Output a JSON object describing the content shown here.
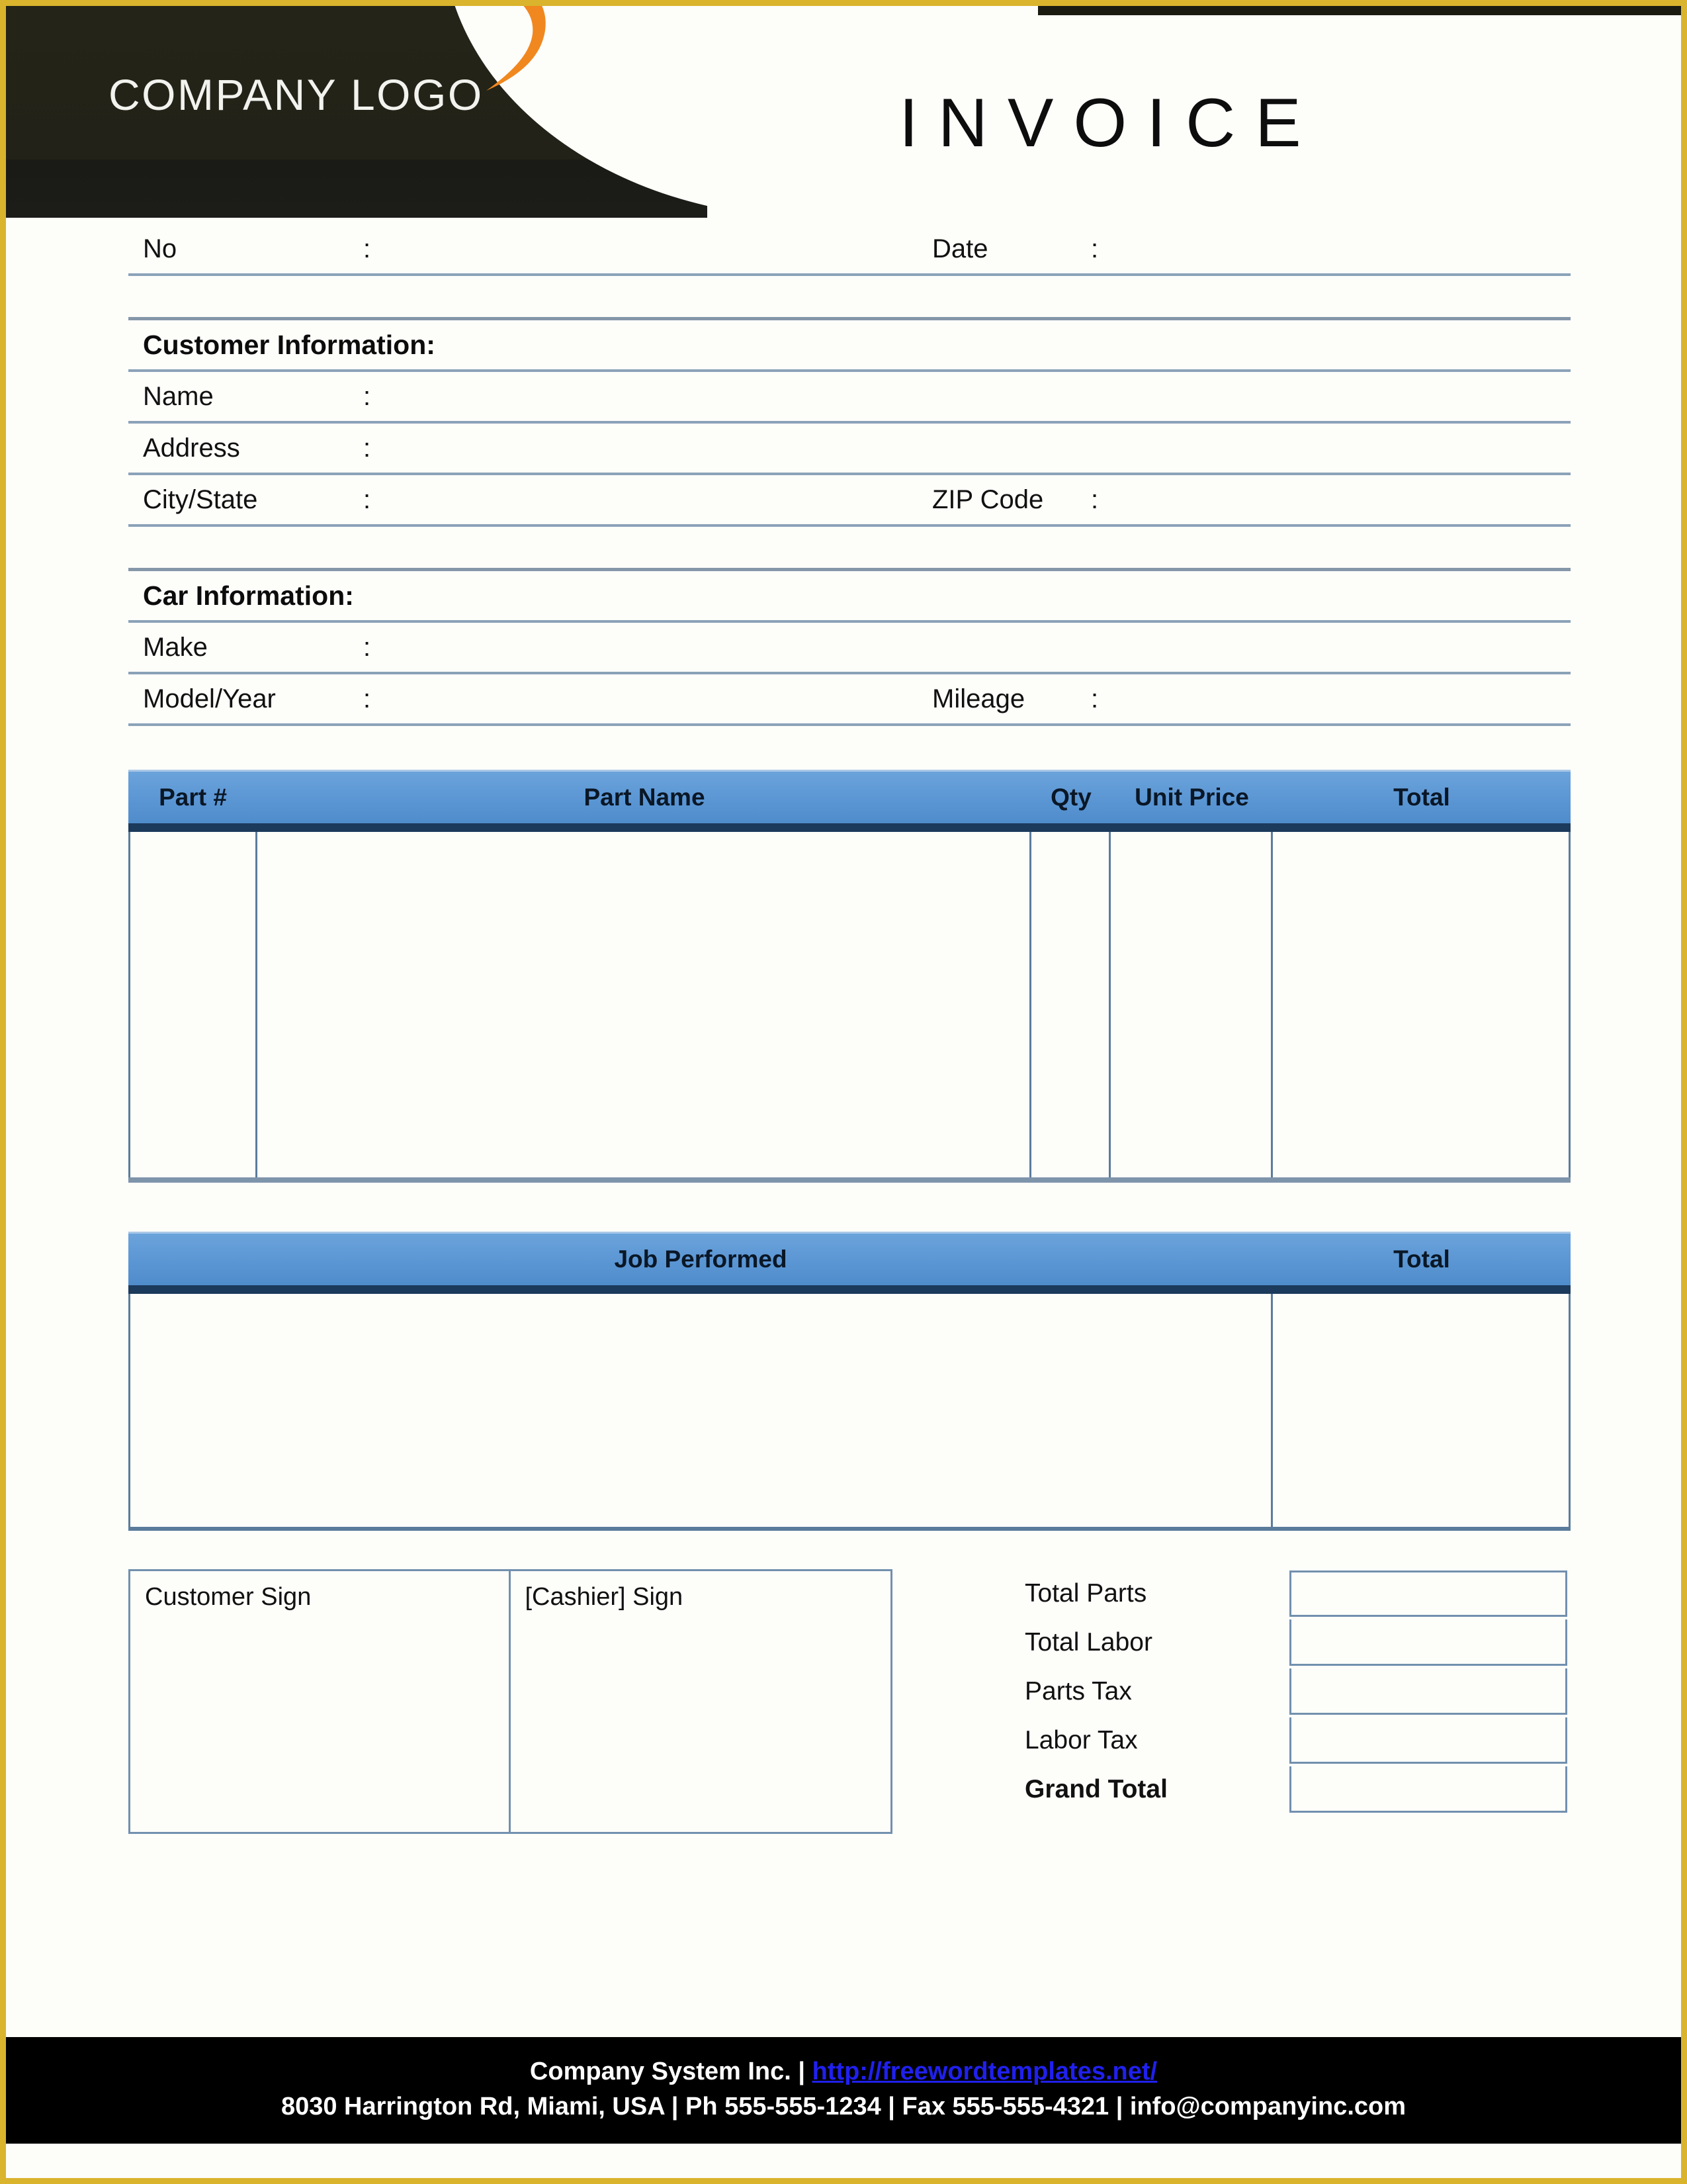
{
  "page": {
    "border_color": "#d9b42c",
    "paper_color": "#fdfdfa"
  },
  "header": {
    "logo_text": "COMPANY LOGO",
    "logo_swoosh_color": "#f0881f",
    "title": "INVOICE",
    "band_color": "#232318"
  },
  "meta_row": {
    "no_label": "No",
    "no_colon": ":",
    "no_value": "",
    "date_label": "Date",
    "date_colon": ":",
    "date_value": ""
  },
  "customer_section": {
    "heading": "Customer Information:",
    "fields": [
      {
        "label": "Name",
        "colon": ":",
        "value": ""
      },
      {
        "label": "Address",
        "colon": ":",
        "value": ""
      },
      {
        "label": "City/State",
        "colon": ":",
        "value": "",
        "label2": "ZIP Code",
        "colon2": ":",
        "value2": ""
      }
    ]
  },
  "car_section": {
    "heading": "Car Information:",
    "fields": [
      {
        "label": "Make",
        "colon": ":",
        "value": ""
      },
      {
        "label": "Model/Year",
        "colon": ":",
        "value": "",
        "label2": "Mileage",
        "colon2": ":",
        "value2": ""
      }
    ]
  },
  "parts_table": {
    "header_color": "#5b96d4",
    "header_rule_color": "#1b3a5c",
    "columns": [
      "Part #",
      "Part Name",
      "Qty",
      "Unit Price",
      "Total"
    ],
    "rows": []
  },
  "job_table": {
    "header_color": "#5b96d4",
    "columns": [
      "Job Performed",
      "Total"
    ],
    "rows": []
  },
  "signatures": {
    "customer_label": "Customer Sign",
    "cashier_label": "[Cashier] Sign"
  },
  "totals": {
    "rows": [
      {
        "label": "Total Parts",
        "value": "",
        "bold": false
      },
      {
        "label": "Total Labor",
        "value": "",
        "bold": false
      },
      {
        "label": "Parts Tax",
        "value": "",
        "bold": false
      },
      {
        "label": "Labor Tax",
        "value": "",
        "bold": false
      },
      {
        "label": "Grand Total",
        "value": "",
        "bold": true
      }
    ]
  },
  "footer": {
    "company": "Company System Inc. |",
    "url": "http://freewordtemplates.net/",
    "address_line": "8030 Harrington Rd, Miami, USA | Ph 555-555-1234 | Fax 555-555-4321 | info@companyinc.com",
    "background": "#000000",
    "url_color": "#2020ee"
  }
}
